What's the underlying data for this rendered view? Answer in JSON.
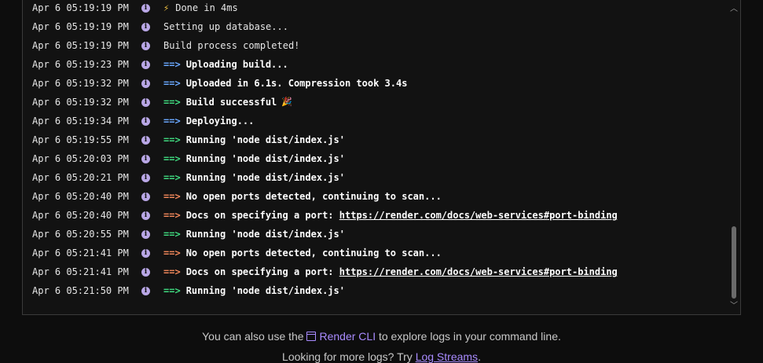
{
  "logs": [
    {
      "ts": "Apr 6 05:19:19 PM",
      "arrow": "",
      "emoji_before": "⚡",
      "msg": "Done in 4ms",
      "link": "",
      "emoji_after": ""
    },
    {
      "ts": "Apr 6 05:19:19 PM",
      "arrow": "",
      "emoji_before": "",
      "msg": "Setting up database...",
      "link": "",
      "emoji_after": ""
    },
    {
      "ts": "Apr 6 05:19:19 PM",
      "arrow": "",
      "emoji_before": "",
      "msg": "Build process completed!",
      "link": "",
      "emoji_after": ""
    },
    {
      "ts": "Apr 6 05:19:23 PM",
      "arrow": "==>",
      "arrow_color": "blue",
      "emoji_before": "",
      "msg": "Uploading build...",
      "link": "",
      "emoji_after": ""
    },
    {
      "ts": "Apr 6 05:19:32 PM",
      "arrow": "==>",
      "arrow_color": "blue",
      "emoji_before": "",
      "msg": "Uploaded in 6.1s. Compression took 3.4s",
      "link": "",
      "emoji_after": ""
    },
    {
      "ts": "Apr 6 05:19:32 PM",
      "arrow": "==>",
      "arrow_color": "green",
      "emoji_before": "",
      "msg": "Build successful",
      "link": "",
      "emoji_after": "🎉"
    },
    {
      "ts": "Apr 6 05:19:34 PM",
      "arrow": "==>",
      "arrow_color": "blue",
      "emoji_before": "",
      "msg": "Deploying...",
      "link": "",
      "emoji_after": ""
    },
    {
      "ts": "Apr 6 05:19:55 PM",
      "arrow": "==>",
      "arrow_color": "green",
      "emoji_before": "",
      "msg": "Running 'node dist/index.js'",
      "link": "",
      "emoji_after": ""
    },
    {
      "ts": "Apr 6 05:20:03 PM",
      "arrow": "==>",
      "arrow_color": "green",
      "emoji_before": "",
      "msg": "Running 'node dist/index.js'",
      "link": "",
      "emoji_after": ""
    },
    {
      "ts": "Apr 6 05:20:21 PM",
      "arrow": "==>",
      "arrow_color": "green",
      "emoji_before": "",
      "msg": "Running 'node dist/index.js'",
      "link": "",
      "emoji_after": ""
    },
    {
      "ts": "Apr 6 05:20:40 PM",
      "arrow": "==>",
      "arrow_color": "orange",
      "emoji_before": "",
      "msg": "No open ports detected, continuing to scan...",
      "link": "",
      "emoji_after": ""
    },
    {
      "ts": "Apr 6 05:20:40 PM",
      "arrow": "==>",
      "arrow_color": "orange",
      "emoji_before": "",
      "msg": "Docs on specifying a port: ",
      "link": "https://render.com/docs/web-services#port-binding",
      "emoji_after": ""
    },
    {
      "ts": "Apr 6 05:20:55 PM",
      "arrow": "==>",
      "arrow_color": "green",
      "emoji_before": "",
      "msg": "Running 'node dist/index.js'",
      "link": "",
      "emoji_after": ""
    },
    {
      "ts": "Apr 6 05:21:41 PM",
      "arrow": "==>",
      "arrow_color": "orange",
      "emoji_before": "",
      "msg": "No open ports detected, continuing to scan...",
      "link": "",
      "emoji_after": ""
    },
    {
      "ts": "Apr 6 05:21:41 PM",
      "arrow": "==>",
      "arrow_color": "orange",
      "emoji_before": "",
      "msg": "Docs on specifying a port: ",
      "link": "https://render.com/docs/web-services#port-binding",
      "emoji_after": ""
    },
    {
      "ts": "Apr 6 05:21:50 PM",
      "arrow": "==>",
      "arrow_color": "green",
      "emoji_before": "",
      "msg": "Running 'node dist/index.js'",
      "link": "",
      "emoji_after": ""
    }
  ],
  "info_icon_glyph": "i",
  "footer": {
    "line1_prefix": "You can also use the ",
    "cli_link": "Render CLI",
    "line1_suffix": " to explore logs in your command line.",
    "line2_prefix": "Looking for more logs? Try ",
    "streams_link": "Log Streams",
    "line2_suffix": "."
  },
  "colors": {
    "arrow_blue": "#6aa8ff",
    "arrow_green": "#3fd97f",
    "arrow_orange": "#f0875a",
    "link_accent": "#a98bff",
    "info_icon": "#b9a7e6"
  },
  "icons": [
    "info-icon",
    "terminal-icon",
    "chevron-up-icon",
    "chevron-down-icon"
  ]
}
